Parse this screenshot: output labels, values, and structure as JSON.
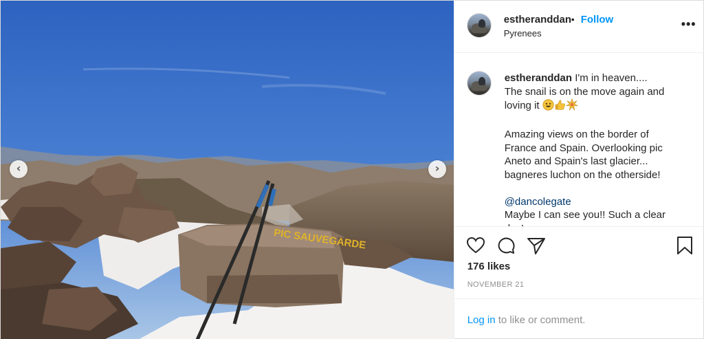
{
  "post": {
    "username": "estheranddan",
    "location": "Pyrenees",
    "follow_label": "Follow",
    "separator": "•",
    "more_icon": "more-options-icon",
    "more_glyph": "•••"
  },
  "photo": {
    "description_icon": "mountain-summit-photo",
    "sign_text": "PIC SAUVEGARDE",
    "prev_glyph": "‹",
    "next_glyph": "›"
  },
  "caption": {
    "username": "estheranddan",
    "line1": "I'm in heaven....",
    "line2": "The snail is on the move again and loving it",
    "emojis": [
      "grinning-face",
      "thumbs-up",
      "sparkle-burst"
    ],
    "paragraph2": "Amazing views on the border of France and Spain. Overlooking pic Aneto and Spain's last glacier... bagneres luchon on the otherside!",
    "mention": "@dancolegate",
    "line_last": "Maybe I can see you!! Such a clear day!"
  },
  "actions": {
    "likes_text": "176 likes",
    "date_text": "NOVEMBER 21",
    "login_link": "Log in",
    "login_rest": " to like or comment."
  },
  "colors": {
    "accent": "#0095f6",
    "text": "#262626",
    "muted": "#8e8e8e"
  }
}
